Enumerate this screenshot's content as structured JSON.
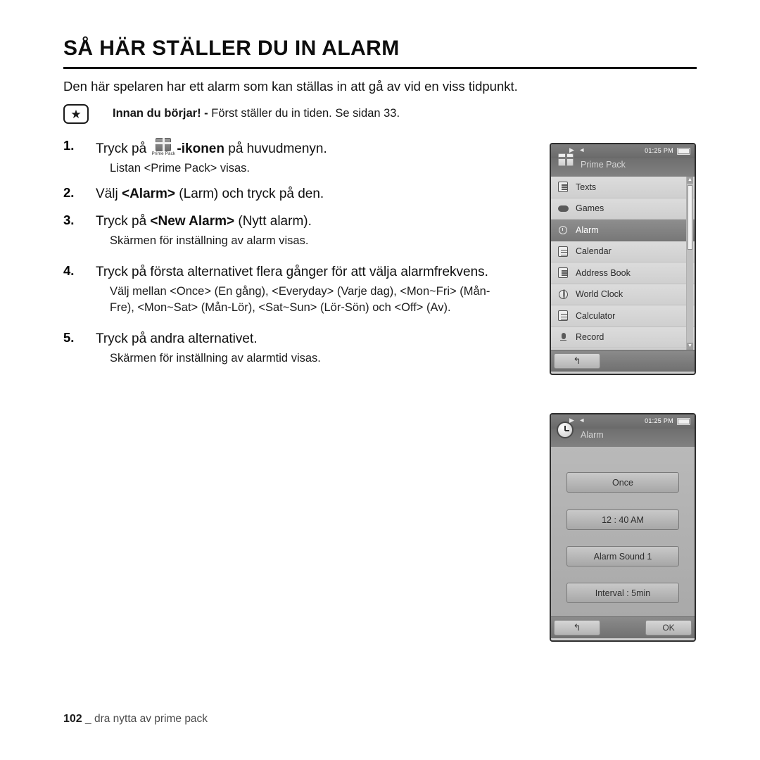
{
  "document": {
    "title": "SÅ HÄR STÄLLER DU IN ALARM",
    "intro": "Den här spelaren har ett alarm som kan ställas in att gå av vid en viss tidpunkt.",
    "note": {
      "icon": "star-icon",
      "bold_lead": "Innan du börjar! -",
      "text": " Först ställer du in tiden. Se sidan 33."
    },
    "steps": [
      {
        "num": "1.",
        "main_before": "Tryck på ",
        "icon_caption": "Prime Pack",
        "main_bold": "-ikonen",
        "main_after": " på huvudmenyn.",
        "sub": "Listan <Prime Pack> visas."
      },
      {
        "num": "2.",
        "main_before": "Välj ",
        "main_bold": "<Alarm>",
        "main_after": " (Larm) och tryck på den.",
        "sub": ""
      },
      {
        "num": "3.",
        "main_before": "Tryck på ",
        "main_bold": "<New Alarm>",
        "main_after": " (Nytt alarm).",
        "sub": "Skärmen för inställning av alarm visas."
      },
      {
        "num": "4.",
        "main_before": "Tryck på första alternativet flera gånger för att välja alarmfrekvens.",
        "main_bold": "",
        "main_after": "",
        "sub": "Välj mellan <Once> (En gång), <Everyday> (Varje dag), <Mon~Fri> (Mån-Fre), <Mon~Sat> (Mån-Lör), <Sat~Sun> (Lör-Sön) och <Off> (Av)."
      },
      {
        "num": "5.",
        "main_before": "Tryck på andra alternativet.",
        "main_bold": "",
        "main_after": "",
        "sub": "Skärmen för inställning av alarmtid visas."
      }
    ],
    "footer": {
      "page": "102",
      "section": "dra nytta av prime pack"
    }
  },
  "device_menu": {
    "status": {
      "left_icons": "▶  ◄",
      "time": "01:25 PM",
      "battery": "battery-icon"
    },
    "header": {
      "icon": "gift-icon",
      "title": "Prime Pack"
    },
    "items": [
      {
        "label": "Texts",
        "icon": "texts-icon",
        "selected": false
      },
      {
        "label": "Games",
        "icon": "games-icon",
        "selected": false
      },
      {
        "label": "Alarm",
        "icon": "alarm-icon",
        "selected": true
      },
      {
        "label": "Calendar",
        "icon": "calendar-icon",
        "selected": false
      },
      {
        "label": "Address Book",
        "icon": "address-book-icon",
        "selected": false
      },
      {
        "label": "World Clock",
        "icon": "world-clock-icon",
        "selected": false
      },
      {
        "label": "Calculator",
        "icon": "calculator-icon",
        "selected": false
      },
      {
        "label": "Record",
        "icon": "record-icon",
        "selected": false
      }
    ],
    "scroll": {
      "up": "▲",
      "down": "▼"
    },
    "footer": {
      "back": "↰"
    }
  },
  "device_alarm": {
    "status": {
      "left_icons": "▶  ◄",
      "time": "01:25 PM",
      "battery": "battery-icon"
    },
    "header": {
      "icon": "clock-icon",
      "title": "Alarm"
    },
    "options": [
      {
        "label": "Once"
      },
      {
        "label": "12 : 40 AM"
      },
      {
        "label": "Alarm Sound 1"
      },
      {
        "label": "Interval : 5min"
      }
    ],
    "footer": {
      "back": "↰",
      "ok": "OK"
    }
  }
}
